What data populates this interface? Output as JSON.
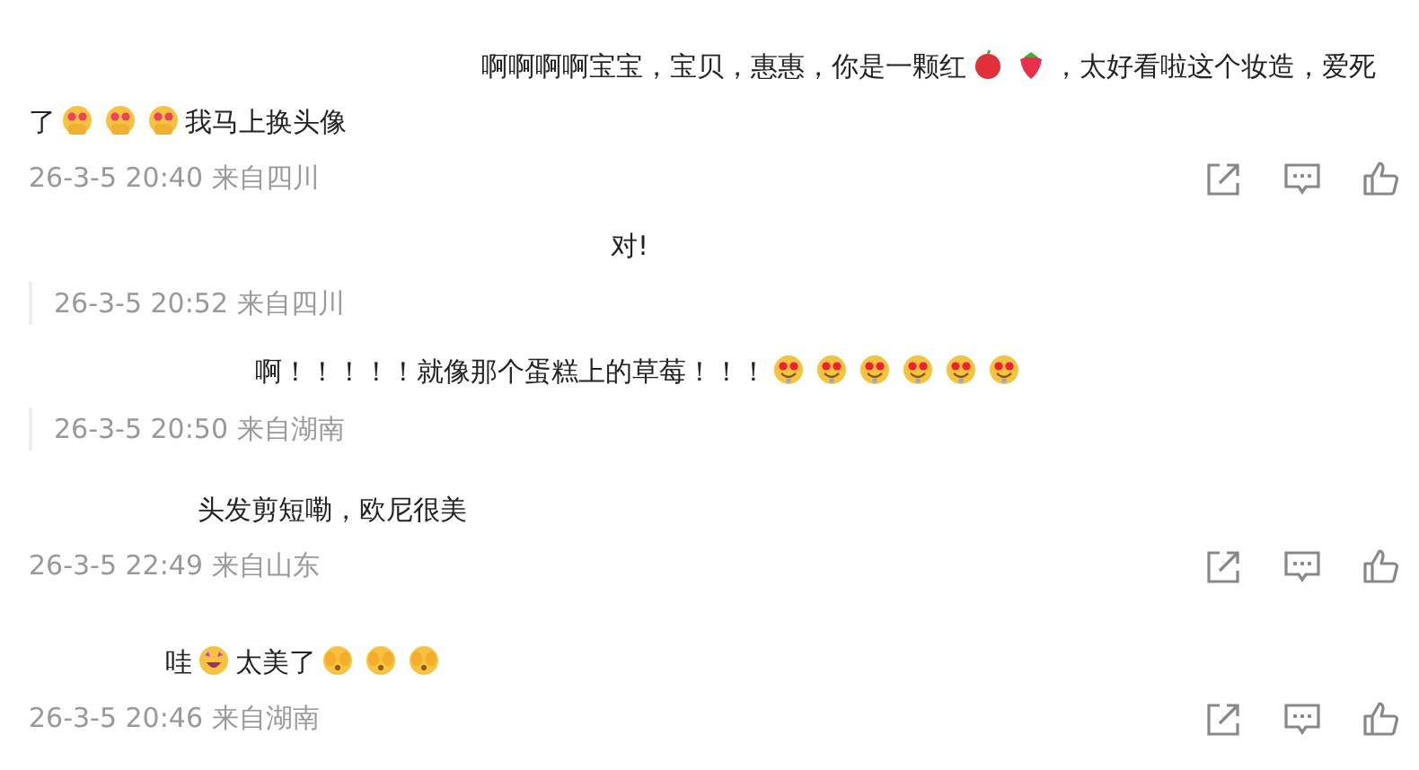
{
  "comments": [
    {
      "kind": "top",
      "parts": [
        {
          "kind": "text",
          "text": "啊啊啊啊宝宝，宝贝，惠惠，你是一颗红"
        },
        {
          "kind": "apple"
        },
        {
          "kind": "strawberry"
        },
        {
          "kind": "text",
          "text": "，太好看啦这个妆造，爱死了"
        },
        {
          "kind": "heart-face"
        },
        {
          "kind": "heart-face"
        },
        {
          "kind": "heart-face"
        },
        {
          "kind": "text",
          "text": "我马上换头像"
        }
      ],
      "meta": "26-3-5 20:40 来自四川"
    },
    {
      "kind": "reply",
      "parts": [
        {
          "kind": "text",
          "text": "对!"
        }
      ],
      "meta": "26-3-5 20:52 来自四川"
    },
    {
      "kind": "reply",
      "parts": [
        {
          "kind": "text",
          "text": "啊！！！！！就像那个蛋糕上的草莓！！！"
        },
        {
          "kind": "drool-face"
        },
        {
          "kind": "drool-face"
        },
        {
          "kind": "drool-face"
        },
        {
          "kind": "drool-face"
        },
        {
          "kind": "drool-face"
        },
        {
          "kind": "drool-face"
        }
      ],
      "meta": "26-3-5 20:50 来自湖南"
    },
    {
      "kind": "top",
      "parts": [
        {
          "kind": "text",
          "text": "头发剪短嘞，欧尼很美"
        }
      ],
      "meta": "26-3-5 22:49 来自山东"
    },
    {
      "kind": "top",
      "parts": [
        {
          "kind": "text",
          "text": "哇"
        },
        {
          "kind": "star-face"
        },
        {
          "kind": "text",
          "text": "太美了"
        },
        {
          "kind": "cover-face"
        },
        {
          "kind": "cover-face"
        },
        {
          "kind": "cover-face"
        }
      ],
      "meta": "26-3-5 20:46 来自湖南"
    }
  ]
}
